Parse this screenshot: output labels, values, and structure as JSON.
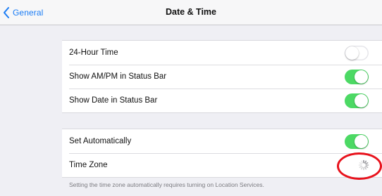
{
  "navbar": {
    "back_label": "General",
    "title": "Date & Time"
  },
  "group1": {
    "rows": [
      {
        "label": "24-Hour Time",
        "toggle": "off"
      },
      {
        "label": "Show AM/PM in Status Bar",
        "toggle": "on"
      },
      {
        "label": "Show Date in Status Bar",
        "toggle": "on"
      }
    ]
  },
  "group2": {
    "rows": [
      {
        "label": "Set Automatically",
        "toggle": "on"
      },
      {
        "label": "Time Zone",
        "status": "loading-spinner-icon"
      }
    ]
  },
  "footer_note": "Setting the time zone automatically requires turning on Location Services.",
  "colors": {
    "accent": "#1a7cf5",
    "toggle_on": "#4cd964",
    "background": "#efeff4",
    "highlight": "#e8121c"
  }
}
